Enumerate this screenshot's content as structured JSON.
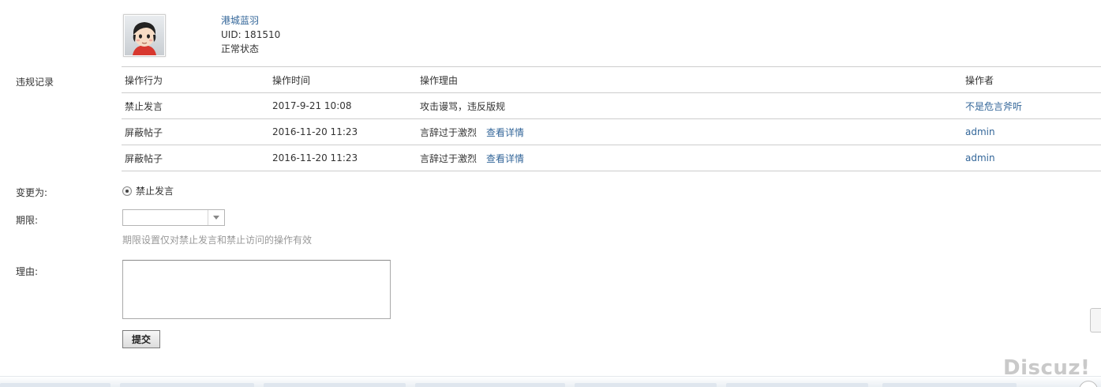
{
  "user": {
    "name": "港城蓝羽",
    "uid": "UID: 181510",
    "status": "正常状态"
  },
  "records": {
    "label": "违规记录",
    "headers": [
      "操作行为",
      "操作时间",
      "操作理由",
      "操作者"
    ],
    "rows": [
      {
        "action": "禁止发言",
        "time": "2017-9-21 10:08",
        "reason": "攻击谩骂，违反版规",
        "detail": "",
        "operator": "不是危言斧听"
      },
      {
        "action": "屏蔽帖子",
        "time": "2016-11-20 11:23",
        "reason": "言辞过于激烈",
        "detail": "查看详情",
        "operator": "admin"
      },
      {
        "action": "屏蔽帖子",
        "time": "2016-11-20 11:23",
        "reason": "言辞过于激烈",
        "detail": "查看详情",
        "operator": "admin"
      }
    ]
  },
  "form": {
    "change_label": "变更为:",
    "change_option": "禁止发言",
    "period_label": "期限:",
    "period_value": "",
    "period_hint": "期限设置仅对禁止发言和禁止访问的操作有效",
    "reason_label": "理由:",
    "reason_value": "",
    "submit_label": "提交"
  },
  "footer": {
    "brand": "Discuz!"
  },
  "colors": {
    "link": "#336699",
    "border": "#cdcdcd",
    "hint": "#999999"
  },
  "icons": {
    "avatar": "cartoon-avatar",
    "select_arrow": "chevron-down-icon"
  }
}
